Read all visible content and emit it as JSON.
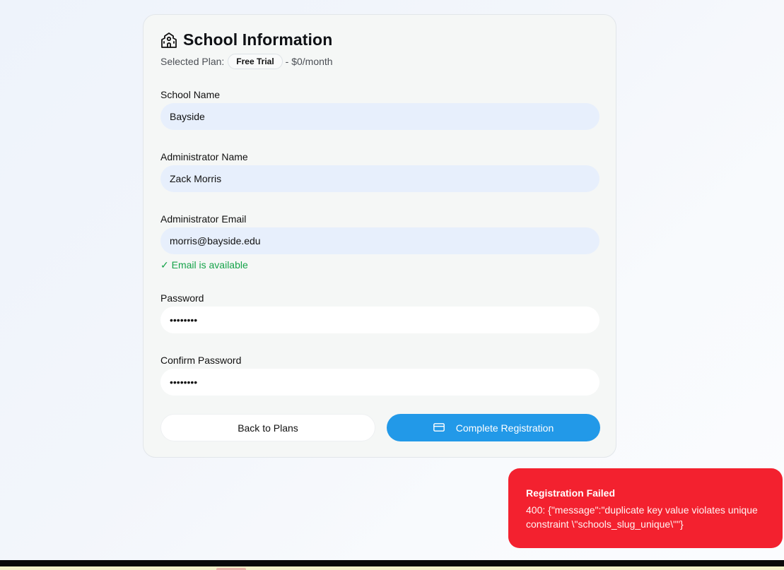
{
  "form": {
    "title": "School Information",
    "title_icon": "school-icon",
    "plan_prefix": "Selected Plan:",
    "plan_name": "Free Trial",
    "plan_price": "- $0/month",
    "fields": {
      "school_name": {
        "label": "School Name",
        "value": "Bayside"
      },
      "admin_name": {
        "label": "Administrator Name",
        "value": "Zack Morris"
      },
      "admin_email": {
        "label": "Administrator Email",
        "value": "morris@bayside.edu"
      },
      "password": {
        "label": "Password",
        "value": "••••••••"
      },
      "confirm_password": {
        "label": "Confirm Password",
        "value": "••••••••"
      }
    },
    "email_status": "✓ Email is available",
    "back_label": "Back to Plans",
    "complete_label": "Complete Registration",
    "complete_icon": "credit-card-icon"
  },
  "toast": {
    "title": "Registration Failed",
    "message": "400: {\"message\":\"duplicate key value violates unique constraint \\\"schools_slug_unique\\\"\"}"
  },
  "colors": {
    "primary": "#2299e8",
    "success": "#16a34a",
    "error": "#f3212f"
  }
}
